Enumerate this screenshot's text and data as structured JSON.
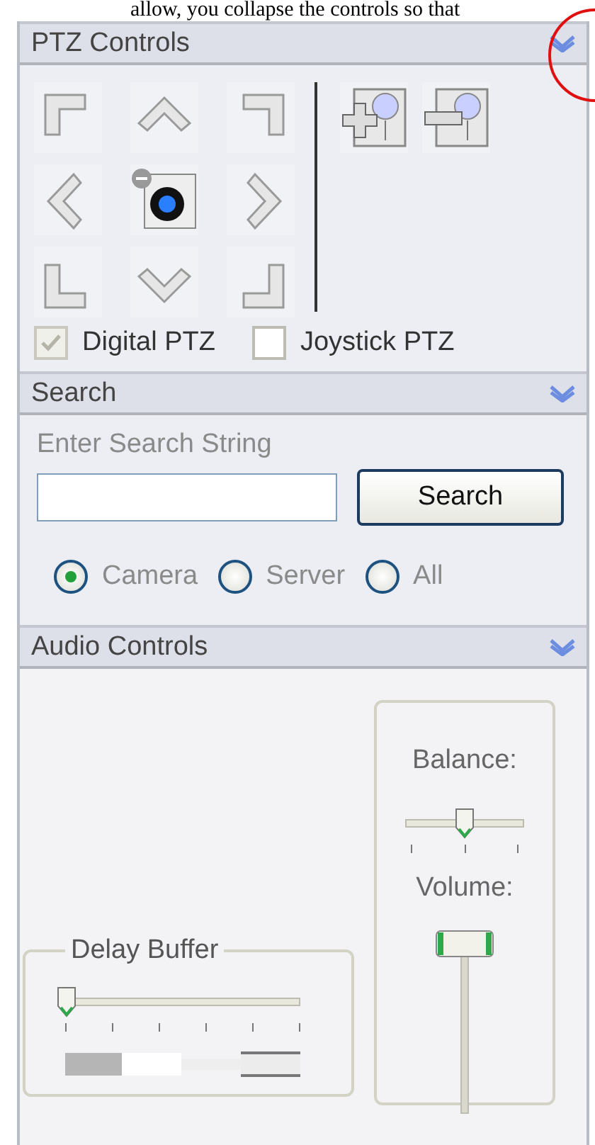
{
  "caption_fragment": "allow, you collapse the controls so that",
  "sections": [
    {
      "kind": "ptz",
      "title": "PTZ Controls",
      "expanded": true,
      "options": [
        {
          "label": "Digital PTZ",
          "checked": true,
          "disabled": true
        },
        {
          "label": "Joystick PTZ",
          "checked": false,
          "disabled": false
        }
      ]
    },
    {
      "kind": "search",
      "title": "Search",
      "expanded": true,
      "label": "Enter Search String",
      "button": "Search",
      "scopes": [
        {
          "label": "Camera",
          "selected": true
        },
        {
          "label": "Server",
          "selected": false
        },
        {
          "label": "All",
          "selected": false
        }
      ]
    },
    {
      "kind": "audio",
      "title": "Audio Controls",
      "expanded": true,
      "delay": {
        "title": "Delay Buffer",
        "level": 0
      },
      "balance": {
        "label": "Balance:",
        "level": 0.5
      },
      "volume": {
        "label": "Volume:",
        "level": 1
      }
    }
  ]
}
